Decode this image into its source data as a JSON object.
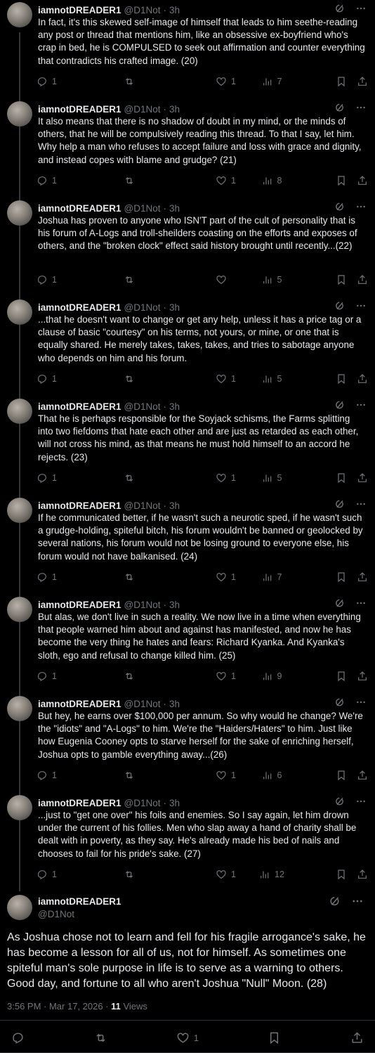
{
  "author": {
    "name": "iamnotDREADER1",
    "handle": "@D1Not",
    "time": "3h"
  },
  "thread": [
    {
      "text": "In fact, it's this skewed self-image of himself that leads to him seethe-reading any post or thread that mentions him, like an obsessive ex-boyfriend who's crap in bed, he is COMPULSED to seek out affirmation and counter everything that contradicts his crafted image. (20)",
      "replies": "1",
      "reposts": "",
      "likes": "1",
      "views": "7"
    },
    {
      "text": "It also means that there is no shadow of doubt in my mind, or the minds of others, that he will be compulsively reading this thread. To that I say, let him. Why help a man who refuses to accept failure and loss with grace and dignity, and instead copes with blame and grudge? (21)",
      "replies": "1",
      "reposts": "",
      "likes": "1",
      "views": "8"
    },
    {
      "text": "Joshua has proven to anyone who ISN'T part of the cult of personality that is his forum of A-Logs and troll-sheilders coasting on the efforts and exposes of others, and the \"broken clock\" effect said history brought until recently...(22)",
      "replies": "1",
      "reposts": "",
      "likes": "",
      "views": "5"
    },
    {
      "text": "...that he doesn't want to change or get any help, unless it has a price tag or a clause of basic \"courtesy\" on his terms, not yours, or mine, or one that is equally shared. He merely takes, takes, takes, and tries to sabotage anyone who depends on him and his forum.",
      "replies": "1",
      "reposts": "",
      "likes": "1",
      "views": "5"
    },
    {
      "text": "That he is perhaps responsible for the Soyjack schisms, the Farms splitting into two fiefdoms that hate each other and are just as retarded as each other, will not cross his mind, as that means he must hold himself to an accord he rejects. (23)",
      "replies": "1",
      "reposts": "",
      "likes": "1",
      "views": "5"
    },
    {
      "text": "If he communicated better, if he wasn't such a neurotic sped, if he wasn't such a grudge-holding, spiteful bitch, his forum wouldn't be banned or geolocked by several nations, his forum would not be losing ground to everyone else, his forum would not have balkanised. (24)",
      "replies": "1",
      "reposts": "",
      "likes": "1",
      "views": "7"
    },
    {
      "text": "But alas, we don't live in such a reality. We now live in a time when everything that people warned him about and against has manifested, and now he has become the very thing he hates and fears: Richard Kyanka. And Kyanka's sloth, ego and refusal to change killed him. (25)",
      "replies": "1",
      "reposts": "",
      "likes": "1",
      "views": "9"
    },
    {
      "text": "But hey, he earns over $100,000 per annum. So why would he change? We're the \"idiots\" and \"A-Logs\" to him. We're the \"Haiders/Haters\" to him. Just like how Eugenia Cooney opts to starve herself for the sake of enriching herself, Joshua opts to gamble everything away...(26)",
      "replies": "1",
      "reposts": "",
      "likes": "1",
      "views": "6"
    },
    {
      "text": "...just to \"get one over\" his foils and enemies. So I say again, let him drown under the current of his follies. Men who slap away a hand of charity shall be dealt with in poverty, as they say. He's already made his bed of nails and chooses to fail for his pride's sake. (27)",
      "replies": "1",
      "reposts": "",
      "likes": "1",
      "views": "12"
    }
  ],
  "main_post": {
    "name": "iamnotDREADER1",
    "handle": "@D1Not",
    "text": "As Joshua chose not to learn and fell for his fragile arrogance's sake, he has become a lesson for all of us, not for himself. As sometimes one spiteful man's sole purpose in life is to serve as a warning to others. Good day, and fortune to all who aren't Joshua \"Null\" Moon. (28)",
    "date": "3:56 PM · Mar 17, 2026 · ",
    "views_count": "11",
    "views_label": " Views",
    "likes": "1"
  },
  "colors": {
    "background": "#000000",
    "text": "#e7e9ea",
    "muted": "#71767b",
    "divider": "#2f3336"
  },
  "icons": [
    "grok-icon",
    "more-icon",
    "reply-icon",
    "repost-icon",
    "like-icon",
    "views-icon",
    "bookmark-icon",
    "share-icon"
  ]
}
